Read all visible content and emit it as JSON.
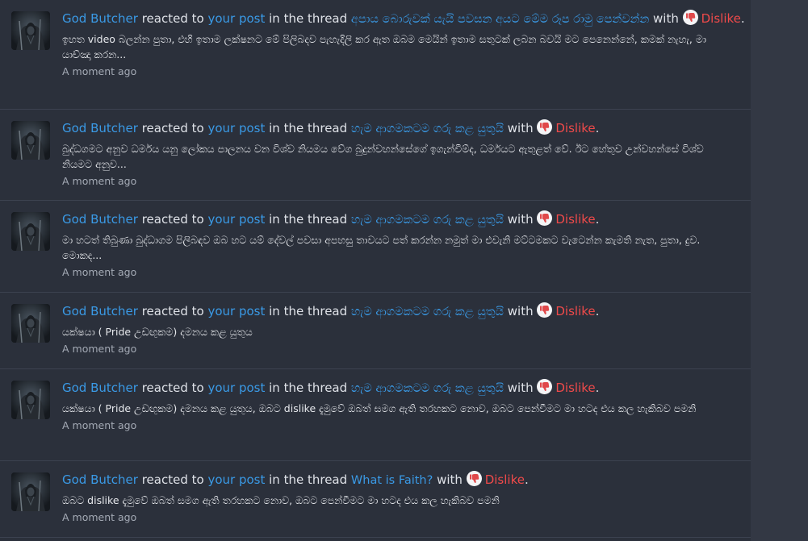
{
  "alerts": [
    {
      "user": "God Butcher",
      "reacted_text": "reacted to",
      "post_link": "your post",
      "in_thread_text": "in the thread",
      "thread": "අපාය බොරුවක් යැයි පවසන අයට මේම රූප රාමු පෙන්වන්න",
      "with_text": "with",
      "reaction": "Dislike",
      "snippet": "ඉහත video බලන්න පුතා, එහි ඉතාම ලක්ෂනට මේ පිලිබදව පැහැදිලි කර ඇත ඔබම මෙයින් ඉතාම සතුටක් ලබන බවයි මට පෙනෙන්නේ, කමක් නැහැ, මා යාච්ඤා කරන...",
      "time": "A moment ago"
    },
    {
      "user": "God Butcher",
      "reacted_text": "reacted to",
      "post_link": "your post",
      "in_thread_text": "in the thread",
      "thread": "හැම ආගමකටම ගරු කළ යුතුයි",
      "with_text": "with",
      "reaction": "Dislike",
      "snippet": "බුද්ධගමට අනුව ධර්මය යනු ලෝකය පාලනය වන විශ්ව නියමය වේග බුදුන්වහන්සේගේ ඉගැන්වීම්ද, ධර්මයට ඇතුළත් වේ. ඊට හේතුව උන්වහන්සේ විශ්ව නියමට අනුව...",
      "time": "A moment ago"
    },
    {
      "user": "God Butcher",
      "reacted_text": "reacted to",
      "post_link": "your post",
      "in_thread_text": "in the thread",
      "thread": "හැම ආගමකටම ගරු කළ යුතුයි",
      "with_text": "with",
      "reaction": "Dislike",
      "snippet": "මා හටත් තිබුණා බුද්ධාගම පිලිබඳව ඔබ හට යම් දේවල් පවසා අපහසු තාවයට පත් කරන්න නමුත් මා එවැනි මට්ටමකට වැටෙන්න කැමති නැත, පුතා, දුව. මොකද...",
      "time": "A moment ago"
    },
    {
      "user": "God Butcher",
      "reacted_text": "reacted to",
      "post_link": "your post",
      "in_thread_text": "in the thread",
      "thread": "හැම ආගමකටම ගරු කළ යුතුයි",
      "with_text": "with",
      "reaction": "Dislike",
      "snippet": "යක්ෂයා ( Pride උඩඟුකම) දමනය කළ යුතුය",
      "time": "A moment ago"
    },
    {
      "user": "God Butcher",
      "reacted_text": "reacted to",
      "post_link": "your post",
      "in_thread_text": "in the thread",
      "thread": "හැම ආගමකටම ගරු කළ යුතුයි",
      "with_text": "with",
      "reaction": "Dislike",
      "snippet": "යක්ෂයා ( Pride උඩඟුකම) දමනය කළ යුතුය, ඔබට dislike දැමුවේ ඔබත් සමග ඇති තරහකට නොව, ඔබට පෙන්වීමට මා හටද එය කල හැකිබව පමනි",
      "time": "A moment ago"
    },
    {
      "user": "God Butcher",
      "reacted_text": "reacted to",
      "post_link": "your post",
      "in_thread_text": "in the thread",
      "thread": "What is Faith?",
      "with_text": "with",
      "reaction": "Dislike",
      "snippet": "ඔබට dislike දැමුවේ ඔබත් සමග ඇති තරහකට නොව, ඔබට පෙන්වීමට මා හටද එය කල හැකිබව පමනි",
      "time": "A moment ago"
    }
  ],
  "icons": {
    "avatar": "hooded-figure-avatar",
    "reaction": "thumbs-down-icon"
  },
  "colors": {
    "link": "#3a9ae6",
    "dislike": "#ef4a4a",
    "background": "#2b303b",
    "muted": "#a4aab5"
  }
}
